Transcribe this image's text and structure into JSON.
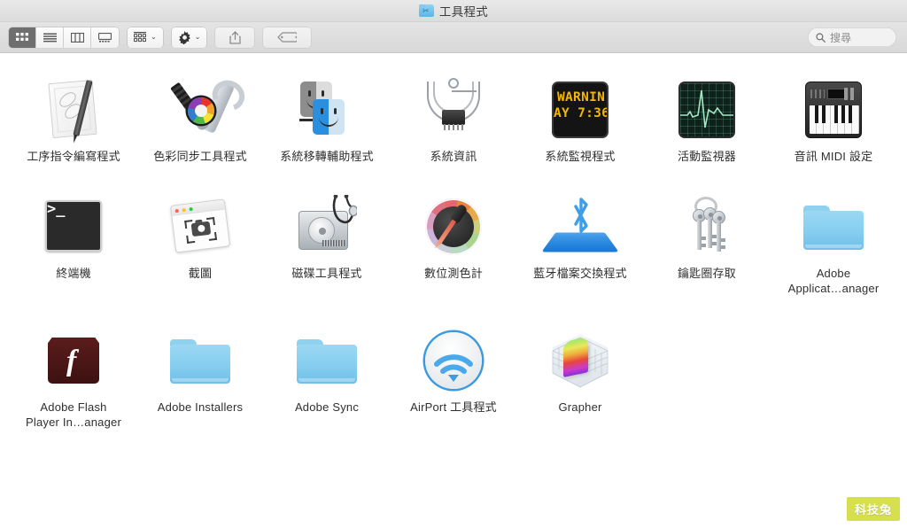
{
  "window": {
    "title": "工具程式",
    "title_icon": "utilities-folder-icon"
  },
  "toolbar": {
    "view_modes": [
      {
        "name": "icon-view",
        "icon": "grid-icon",
        "active": true
      },
      {
        "name": "list-view",
        "icon": "list-icon",
        "active": false
      },
      {
        "name": "column-view",
        "icon": "columns-icon",
        "active": false
      },
      {
        "name": "gallery-view",
        "icon": "gallery-icon",
        "active": false
      }
    ],
    "group_button": {
      "name": "group-items-button",
      "icon": "grid-small-icon",
      "chevron": "⌄"
    },
    "action_button": {
      "name": "action-menu-button",
      "icon": "gear-icon",
      "chevron": "⌄"
    },
    "share_button": {
      "name": "share-button",
      "icon": "share-icon"
    },
    "tags_button": {
      "name": "tags-button",
      "icon": "tag-icon"
    }
  },
  "search": {
    "placeholder": "搜尋",
    "value": "",
    "icon": "search-icon"
  },
  "items": [
    {
      "label1": "工序指令編寫程式",
      "label2": "",
      "icon": "script-editor-icon",
      "kind": "app"
    },
    {
      "label1": "色彩同步工具程式",
      "label2": "",
      "icon": "colorsync-utility-icon",
      "kind": "app"
    },
    {
      "label1": "系統移轉輔助程式",
      "label2": "",
      "icon": "migration-assistant-icon",
      "kind": "app"
    },
    {
      "label1": "系統資訊",
      "label2": "",
      "icon": "system-information-icon",
      "kind": "app"
    },
    {
      "label1": "系統監視程式",
      "label2": "",
      "icon": "console-icon",
      "kind": "app"
    },
    {
      "label1": "活動監視器",
      "label2": "",
      "icon": "activity-monitor-icon",
      "kind": "app"
    },
    {
      "label1": "音訊 MIDI 設定",
      "label2": "",
      "icon": "audio-midi-setup-icon",
      "kind": "app"
    },
    {
      "label1": "終端機",
      "label2": "",
      "icon": "terminal-icon",
      "kind": "app"
    },
    {
      "label1": "截圖",
      "label2": "",
      "icon": "screenshot-icon",
      "kind": "app"
    },
    {
      "label1": "磁碟工具程式",
      "label2": "",
      "icon": "disk-utility-icon",
      "kind": "app"
    },
    {
      "label1": "數位測色計",
      "label2": "",
      "icon": "digital-color-meter-icon",
      "kind": "app"
    },
    {
      "label1": "藍牙檔案交換程式",
      "label2": "",
      "icon": "bluetooth-file-exchange-icon",
      "kind": "app"
    },
    {
      "label1": "鑰匙圈存取",
      "label2": "",
      "icon": "keychain-access-icon",
      "kind": "app"
    },
    {
      "label1": "Adobe",
      "label2": "Applicat…anager",
      "icon": "folder-icon",
      "kind": "folder"
    },
    {
      "label1": "Adobe Flash",
      "label2": "Player In…anager",
      "icon": "flash-player-icon",
      "kind": "app"
    },
    {
      "label1": "Adobe Installers",
      "label2": "",
      "icon": "folder-icon",
      "kind": "folder"
    },
    {
      "label1": "Adobe Sync",
      "label2": "",
      "icon": "folder-icon",
      "kind": "folder"
    },
    {
      "label1": "AirPort 工具程式",
      "label2": "",
      "icon": "airport-utility-icon",
      "kind": "app"
    },
    {
      "label1": "Grapher",
      "label2": "",
      "icon": "grapher-icon",
      "kind": "app"
    }
  ],
  "console_icon_text": {
    "line1": "WARNIN",
    "line2": "AY 7:36",
    "color": "#f2b705"
  },
  "terminal_icon_text": {
    "prompt": ">_"
  },
  "flash_icon_text": {
    "glyph": "f"
  },
  "watermark": {
    "text": "科技兔",
    "color": "#d6e04f"
  }
}
